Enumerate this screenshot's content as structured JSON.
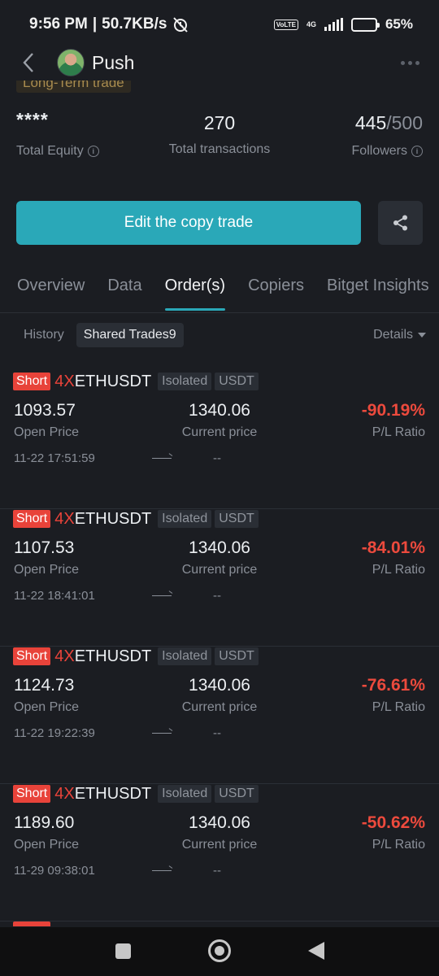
{
  "status_bar": {
    "time": "9:56 PM",
    "separator": "|",
    "speed": "50.7KB/s",
    "network": "4G",
    "volte": "VoLTE",
    "battery": "65%",
    "battery_level": 0.65
  },
  "header": {
    "title": "Push"
  },
  "profile": {
    "tag": "Long-Term trade"
  },
  "stats": {
    "equity_value": "****",
    "equity_label": "Total Equity",
    "transactions_value": "270",
    "transactions_label": "Total transactions",
    "followers_current": "445",
    "followers_max": "/500",
    "followers_label": "Followers"
  },
  "actions": {
    "edit_label": "Edit the copy trade"
  },
  "tabs": [
    {
      "label": "Overview"
    },
    {
      "label": "Data"
    },
    {
      "label": "Order(s)"
    },
    {
      "label": "Copiers"
    },
    {
      "label": "Bitget Insights"
    }
  ],
  "subtabs": {
    "history": "History",
    "shared": "Shared Trades9",
    "details": "Details"
  },
  "trades": [
    {
      "side": "Short",
      "leverage": "4X",
      "symbol": "ETHUSDT",
      "margin": "Isolated",
      "coin": "USDT",
      "open_price": "1093.57",
      "open_label": "Open Price",
      "current_price": "1340.06",
      "current_label": "Current price",
      "pl": "-90.19%",
      "pl_label": "P/L Ratio",
      "open_time": "11-22 17:51:59",
      "close_time": "--"
    },
    {
      "side": "Short",
      "leverage": "4X",
      "symbol": "ETHUSDT",
      "margin": "Isolated",
      "coin": "USDT",
      "open_price": "1107.53",
      "open_label": "Open Price",
      "current_price": "1340.06",
      "current_label": "Current price",
      "pl": "-84.01%",
      "pl_label": "P/L Ratio",
      "open_time": "11-22 18:41:01",
      "close_time": "--"
    },
    {
      "side": "Short",
      "leverage": "4X",
      "symbol": "ETHUSDT",
      "margin": "Isolated",
      "coin": "USDT",
      "open_price": "1124.73",
      "open_label": "Open Price",
      "current_price": "1340.06",
      "current_label": "Current price",
      "pl": "-76.61%",
      "pl_label": "P/L Ratio",
      "open_time": "11-22 19:22:39",
      "close_time": "--"
    },
    {
      "side": "Short",
      "leverage": "4X",
      "symbol": "ETHUSDT",
      "margin": "Isolated",
      "coin": "USDT",
      "open_price": "1189.60",
      "open_label": "Open Price",
      "current_price": "1340.06",
      "current_label": "Current price",
      "pl": "-50.62%",
      "pl_label": "P/L Ratio",
      "open_time": "11-29 09:38:01",
      "close_time": "--"
    }
  ],
  "colors": {
    "accent": "#2aa8b8",
    "loss": "#ec4a3d",
    "background": "#1b1d22"
  }
}
